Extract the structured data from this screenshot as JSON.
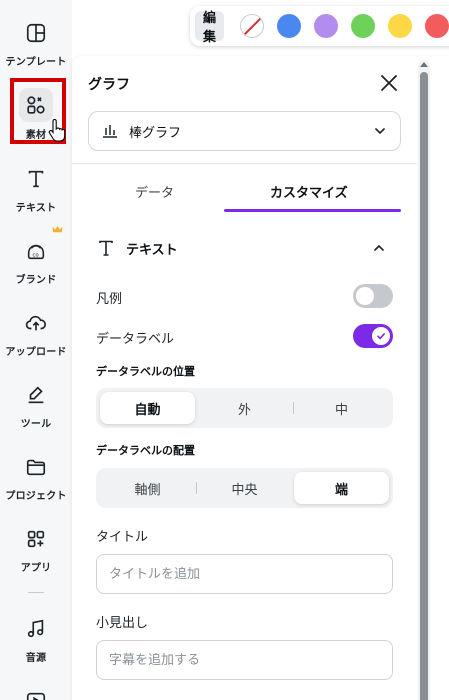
{
  "sidebar": {
    "items": [
      {
        "label": "テンプレート",
        "icon": "template-icon"
      },
      {
        "label": "素材",
        "icon": "elements-icon",
        "active": true
      },
      {
        "label": "テキスト",
        "icon": "text-icon"
      },
      {
        "label": "ブランド",
        "icon": "brand-icon",
        "badge_icon": "crown-icon"
      },
      {
        "label": "アップロード",
        "icon": "upload-icon"
      },
      {
        "label": "ツール",
        "icon": "draw-tool-icon"
      },
      {
        "label": "プロジェクト",
        "icon": "folder-icon"
      },
      {
        "label": "アプリ",
        "icon": "apps-icon"
      },
      {
        "label": "音源",
        "icon": "music-icon"
      }
    ]
  },
  "color_toolbar": {
    "edit_label": "編集",
    "swatches": [
      "none",
      "#4a87f0",
      "#b38cf0",
      "#6dd15a",
      "#fcd846",
      "#f25c5c"
    ]
  },
  "panel": {
    "title": "グラフ",
    "chart_type_select": {
      "icon": "bar-chart-icon",
      "value": "棒グラフ"
    },
    "tabs": [
      {
        "label": "データ",
        "active": false
      },
      {
        "label": "カスタマイズ",
        "active": true
      }
    ],
    "section": {
      "icon": "text-t-icon",
      "title": "テキスト",
      "expanded": true
    },
    "toggles": [
      {
        "label": "凡例",
        "on": false
      },
      {
        "label": "データラベル",
        "on": true
      }
    ],
    "label_position": {
      "title": "データラベルの位置",
      "options": [
        "自動",
        "外",
        "中"
      ],
      "selected": "自動"
    },
    "label_alignment": {
      "title": "データラベルの配置",
      "options": [
        "軸側",
        "中央",
        "端"
      ],
      "selected": "端"
    },
    "title_field": {
      "label": "タイトル",
      "placeholder": "タイトルを追加",
      "value": ""
    },
    "subtitle_field": {
      "label": "小見出し",
      "placeholder": "字幕を追加する",
      "value": ""
    }
  },
  "colors": {
    "accent": "#7d2ae8",
    "highlight_box": "#d40000"
  }
}
